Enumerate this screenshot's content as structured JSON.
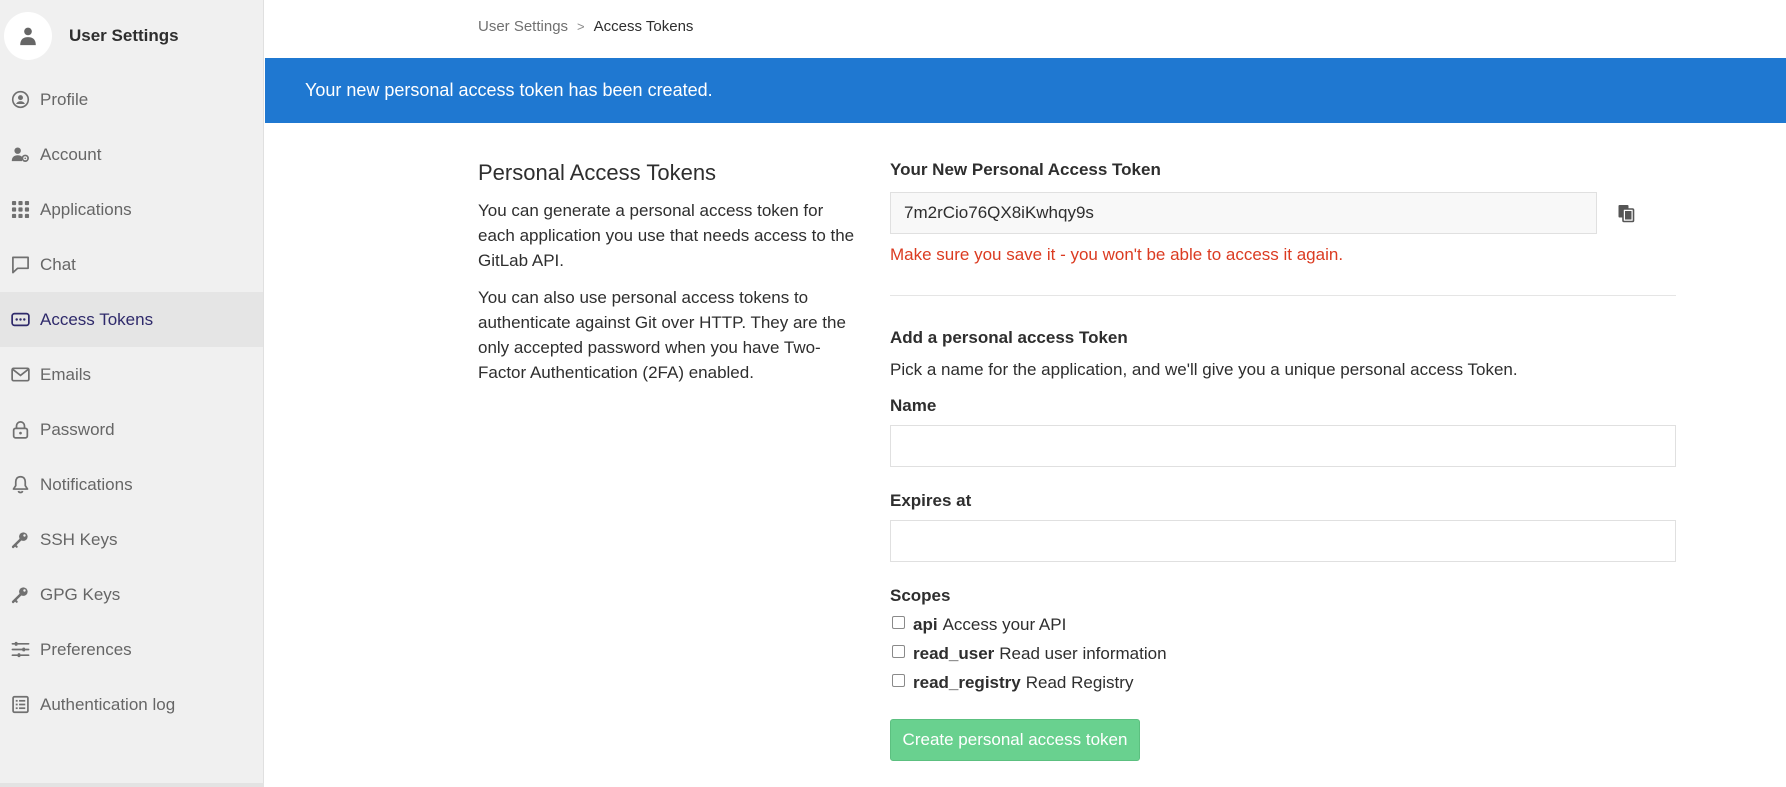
{
  "sidebar": {
    "title": "User Settings",
    "items": [
      {
        "label": "Profile",
        "icon": "profile-icon"
      },
      {
        "label": "Account",
        "icon": "account-icon"
      },
      {
        "label": "Applications",
        "icon": "applications-icon"
      },
      {
        "label": "Chat",
        "icon": "chat-icon"
      },
      {
        "label": "Access Tokens",
        "icon": "access-tokens-icon",
        "active": true
      },
      {
        "label": "Emails",
        "icon": "envelope-icon"
      },
      {
        "label": "Password",
        "icon": "lock-icon"
      },
      {
        "label": "Notifications",
        "icon": "bell-icon"
      },
      {
        "label": "SSH Keys",
        "icon": "key-icon"
      },
      {
        "label": "GPG Keys",
        "icon": "key-icon"
      },
      {
        "label": "Preferences",
        "icon": "preferences-icon"
      },
      {
        "label": "Authentication log",
        "icon": "log-icon"
      }
    ]
  },
  "breadcrumb": {
    "parent": "User Settings",
    "separator": ">",
    "current": "Access Tokens"
  },
  "flash": {
    "message": "Your new personal access token has been created."
  },
  "intro": {
    "title": "Personal Access Tokens",
    "paragraph1": "You can generate a personal access token for each application you use that needs access to the GitLab API.",
    "paragraph2": "You can also use personal access tokens to authenticate against Git over HTTP. They are the only accepted password when you have Two-Factor Authentication (2FA) enabled."
  },
  "new_token": {
    "label": "Your New Personal Access Token",
    "value": "7m2rCio76QX8iKwhqy9s",
    "warning": "Make sure you save it - you won't be able to access it again."
  },
  "form": {
    "title": "Add a personal access Token",
    "description": "Pick a name for the application, and we'll give you a unique personal access Token.",
    "name_label": "Name",
    "name_value": "",
    "expires_label": "Expires at",
    "expires_value": "",
    "scopes_label": "Scopes",
    "scopes": [
      {
        "name": "api",
        "description": "Access your API",
        "checked": false
      },
      {
        "name": "read_user",
        "description": "Read user information",
        "checked": false
      },
      {
        "name": "read_registry",
        "description": "Read Registry",
        "checked": false
      }
    ],
    "submit_label": "Create personal access token"
  },
  "colors": {
    "flash_bg": "#1f78d1",
    "warning": "#db3b21",
    "submit_bg": "#69d18f",
    "active_nav": "#2f2a6b"
  }
}
